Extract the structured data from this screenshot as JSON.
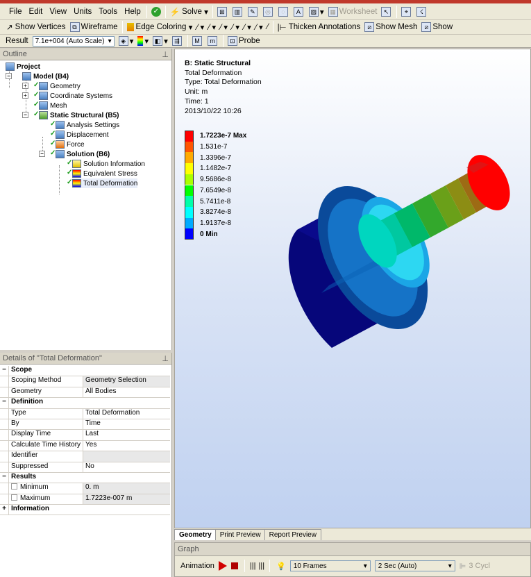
{
  "menu": {
    "items": [
      "File",
      "Edit",
      "View",
      "Units",
      "Tools",
      "Help"
    ],
    "solve": "Solve",
    "worksheet": "Worksheet"
  },
  "toolbar2": {
    "show_vertices": "Show Vertices",
    "wireframe": "Wireframe",
    "edge_coloring": "Edge Coloring",
    "thicken": "Thicken Annotations",
    "show_mesh": "Show Mesh",
    "show_more": "Show"
  },
  "toolbar3": {
    "result_label": "Result",
    "result_scale": "7.1e+004 (Auto Scale)",
    "probe": "Probe"
  },
  "outline": {
    "title": "Outline",
    "nodes": [
      "Project",
      "Model (B4)",
      "Geometry",
      "Coordinate Systems",
      "Mesh",
      "Static Structural (B5)",
      "Analysis Settings",
      "Displacement",
      "Force",
      "Solution (B6)",
      "Solution Information",
      "Equivalent Stress",
      "Total Deformation"
    ]
  },
  "details": {
    "title": "Details of \"Total Deformation\"",
    "rows": [
      {
        "k": "Scope",
        "v": "",
        "section": true
      },
      {
        "k": "Scoping Method",
        "v": "Geometry Selection"
      },
      {
        "k": "Geometry",
        "v": "All Bodies"
      },
      {
        "k": "Definition",
        "v": "",
        "section": true
      },
      {
        "k": "Type",
        "v": "Total Deformation"
      },
      {
        "k": "By",
        "v": "Time"
      },
      {
        "k": "Display Time",
        "v": "Last"
      },
      {
        "k": "Calculate Time History",
        "v": "Yes"
      },
      {
        "k": "Identifier",
        "v": ""
      },
      {
        "k": "Suppressed",
        "v": "No"
      },
      {
        "k": "Results",
        "v": "",
        "section": true
      },
      {
        "k": "Minimum",
        "v": "0. m"
      },
      {
        "k": "Maximum",
        "v": "1.7223e-007 m"
      },
      {
        "k": "Information",
        "v": "",
        "section": true
      }
    ]
  },
  "viewport": {
    "lines": [
      "B: Static Structural",
      "Total Deformation",
      "Type: Total Deformation",
      "Unit: m",
      "Time: 1",
      "2013/10/22 10:26"
    ],
    "legend": [
      {
        "label": "1.7223e-7 Max",
        "color": "#ff0000"
      },
      {
        "label": "1.531e-7",
        "color": "#ff5500"
      },
      {
        "label": "1.3396e-7",
        "color": "#ffaa00"
      },
      {
        "label": "1.1482e-7",
        "color": "#ffff00"
      },
      {
        "label": "9.5686e-8",
        "color": "#aaff00"
      },
      {
        "label": "7.6549e-8",
        "color": "#00ff00"
      },
      {
        "label": "5.7411e-8",
        "color": "#00ffaa"
      },
      {
        "label": "3.8274e-8",
        "color": "#00ffff"
      },
      {
        "label": "1.9137e-8",
        "color": "#00aaff"
      },
      {
        "label": "0 Min",
        "color": "#0000ff"
      }
    ]
  },
  "viewtabs": [
    "Geometry",
    "Print Preview",
    "Report Preview"
  ],
  "graph": {
    "title": "Graph",
    "animation": "Animation",
    "frames": "10 Frames",
    "duration": "2 Sec (Auto)",
    "cycles": "3 Cycl"
  }
}
